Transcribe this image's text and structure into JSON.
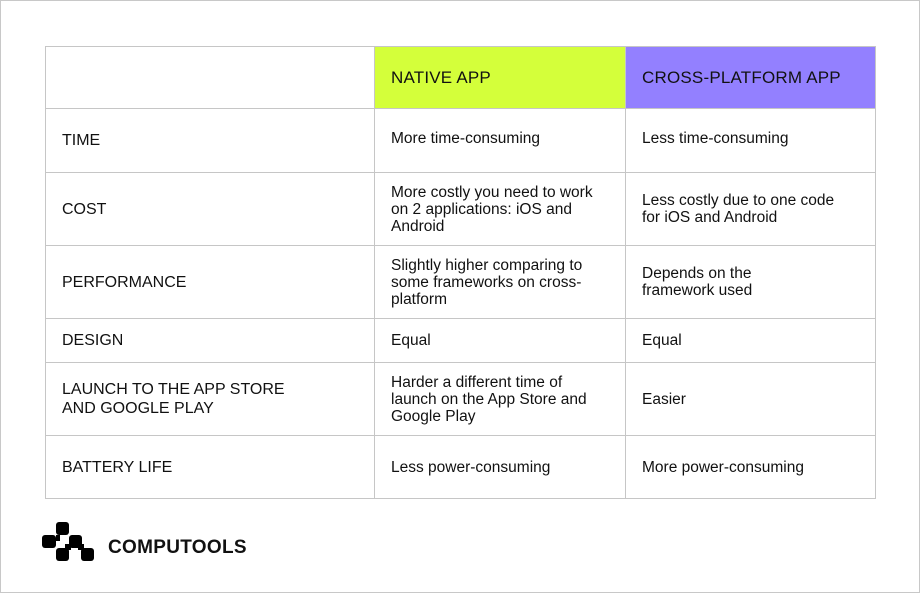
{
  "table": {
    "header": {
      "blank": "",
      "native": "NATIVE APP",
      "cross": "CROSS-PLATFORM APP"
    },
    "colors": {
      "native": "#d4ff3a",
      "cross": "#9380ff",
      "border": "#c6c6c6"
    },
    "rows": [
      {
        "label": "TIME",
        "native": "More time-consuming",
        "cross": "Less time-consuming"
      },
      {
        "label": "COST",
        "native": "More costly you need to work on 2 applications: iOS and Android",
        "cross": "Less costly due to one code for iOS and Android"
      },
      {
        "label": "PERFORMANCE",
        "native": "Slightly higher comparing to some frameworks on cross-platform",
        "cross": "Depends on the framework used"
      },
      {
        "label": "DESIGN",
        "native": "Equal",
        "cross": "Equal"
      },
      {
        "label": "LAUNCH TO THE APP STORE AND GOOGLE PLAY",
        "native": "Harder a different time of launch on the App Store and Google Play",
        "cross": "Easier"
      },
      {
        "label": "BATTERY LIFE",
        "native": "Less power-consuming",
        "cross": "More power-consuming"
      }
    ]
  },
  "brand": {
    "logo_icon": "computools-logo-icon",
    "name": "COMPUTOOLS"
  }
}
